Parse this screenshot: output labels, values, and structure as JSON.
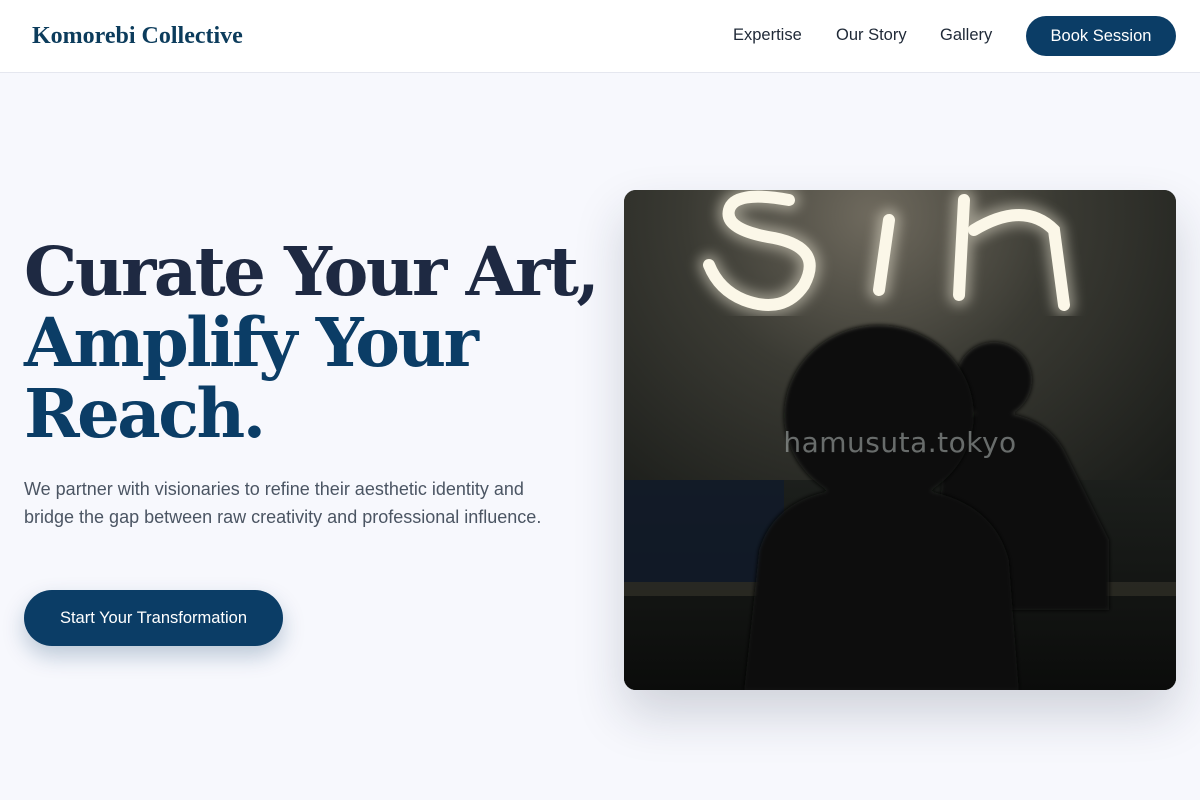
{
  "nav": {
    "brand": "Komorebi Collective",
    "links": [
      "Expertise",
      "Our Story",
      "Gallery"
    ],
    "cta": "Book Session"
  },
  "hero": {
    "title_lines": [
      "Curate Your Art,",
      "Amplify Your",
      "Reach."
    ],
    "description": "We partner with visionaries to refine their aesthetic identity and bridge the gap between raw creativity and professional influence.",
    "cta": "Start Your Transformation"
  },
  "image": {
    "watermark": "hamusuta.tokyo",
    "subject": "person silhouette in front of neon sign"
  },
  "colors": {
    "accent": "#0b3d66",
    "heading_dark": "#1e2942",
    "background": "#f7f8fd"
  }
}
